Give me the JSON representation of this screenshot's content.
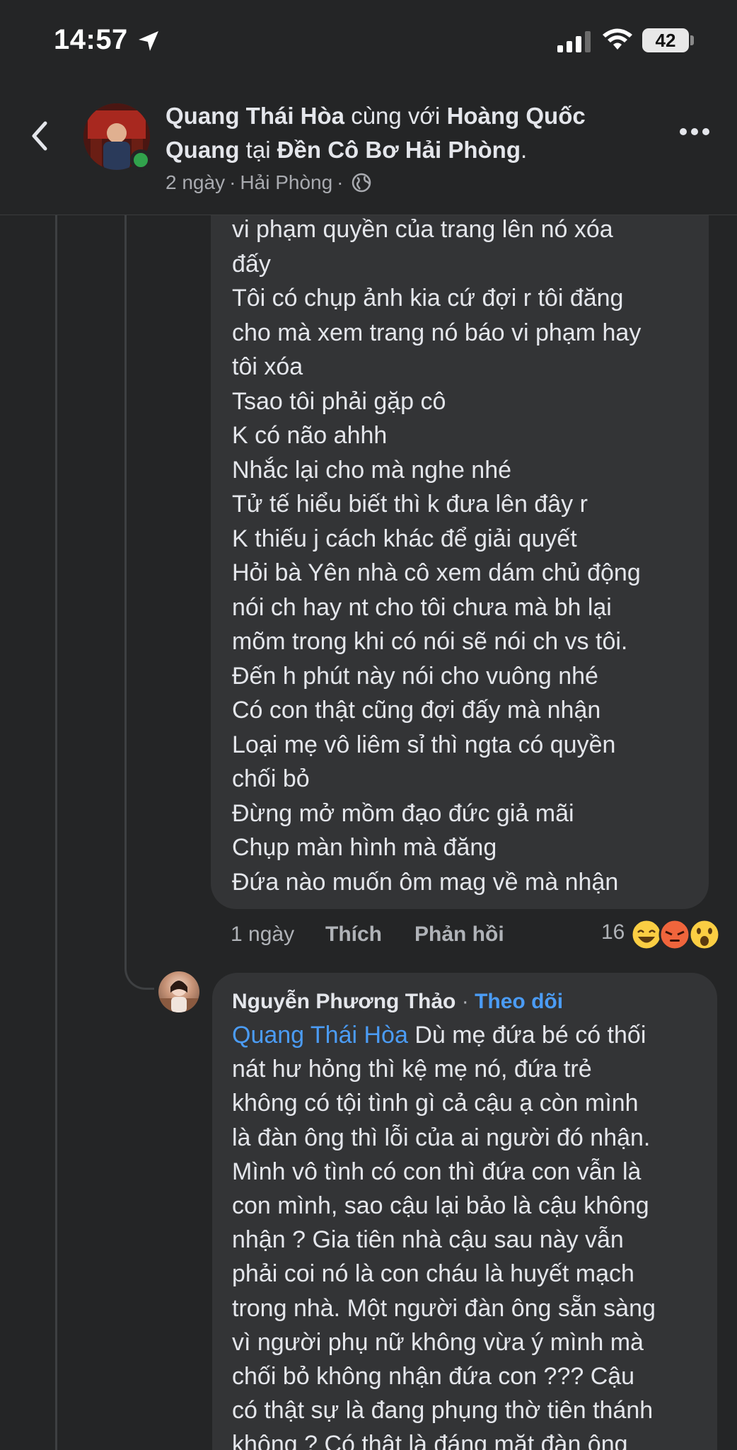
{
  "status_bar": {
    "time": "14:57",
    "battery": "42",
    "location_icon": "location-arrow-icon",
    "signal_icon": "cellular-signal-icon",
    "wifi_icon": "wifi-icon"
  },
  "post_header": {
    "author": "Quang Thái Hòa",
    "with_word": "cùng với",
    "tagged": "Hoàng Quốc Quang",
    "at_word": "tại",
    "place": "Đền Cô Bơ Hải Phòng",
    "time": "2 ngày",
    "location": "Hải Phòng",
    "separator": "·",
    "privacy_icon": "globe-icon"
  },
  "comment_1": {
    "lines": [
      "vi phạm quyền của trang lên nó xóa",
      "đấy",
      "Tôi có chụp ảnh kia cứ đợi r tôi đăng",
      "cho mà xem trang nó báo vi phạm hay",
      "tôi xóa",
      "Tsao tôi phải gặp cô",
      "K có não ahhh",
      "Nhắc lại cho mà nghe nhé",
      "Tử tế hiểu biết thì k đưa lên đây r",
      "K thiếu j cách khác để giải quyết",
      "Hỏi bà Yên nhà cô xem dám chủ động",
      "nói ch hay nt cho tôi chưa mà bh lại",
      "mõm trong khi có nói sẽ nói ch vs tôi.",
      "Đến h phút này nói cho vuông nhé",
      "Có con thật cũng đợi đấy mà nhận",
      "Loại mẹ vô liêm sỉ thì ngta có quyền",
      "chối bỏ",
      "Đừng mở mồm đạo đức giả mãi",
      "Chụp màn hình mà đăng",
      "Đứa nào muốn ôm mag về mà nhận"
    ],
    "time": "1 ngày",
    "like_label": "Thích",
    "reply_label": "Phản hồi",
    "reaction_count": "16",
    "reactions": [
      "haha",
      "angry",
      "wow"
    ]
  },
  "comment_2": {
    "author": "Nguyễn Phương Thảo",
    "separator": "·",
    "follow_label": "Theo dõi",
    "mention": "Quang Thái Hòa",
    "first_line_rest": " Dù mẹ đứa bé có thối",
    "lines": [
      "nát hư hỏng thì kệ mẹ nó, đứa trẻ",
      "không có tội tình gì cả cậu ạ còn mình",
      "là đàn ông thì lỗi của ai người đó nhận.",
      "Mình vô tình có con thì đứa con vẫn là",
      "con mình, sao cậu lại bảo là cậu không",
      "nhận ? Gia tiên nhà cậu sau này vẫn",
      "phải coi nó là con cháu là huyết mạch",
      "trong nhà. Một người đàn ông sẵn sàng",
      "vì người phụ nữ không vừa ý mình mà",
      "chối bỏ không nhận đứa con ??? Cậu",
      "có thật sự là đang phụng thờ tiên thánh",
      "không ? Có thật là đáng mặt đàn ông"
    ]
  }
}
